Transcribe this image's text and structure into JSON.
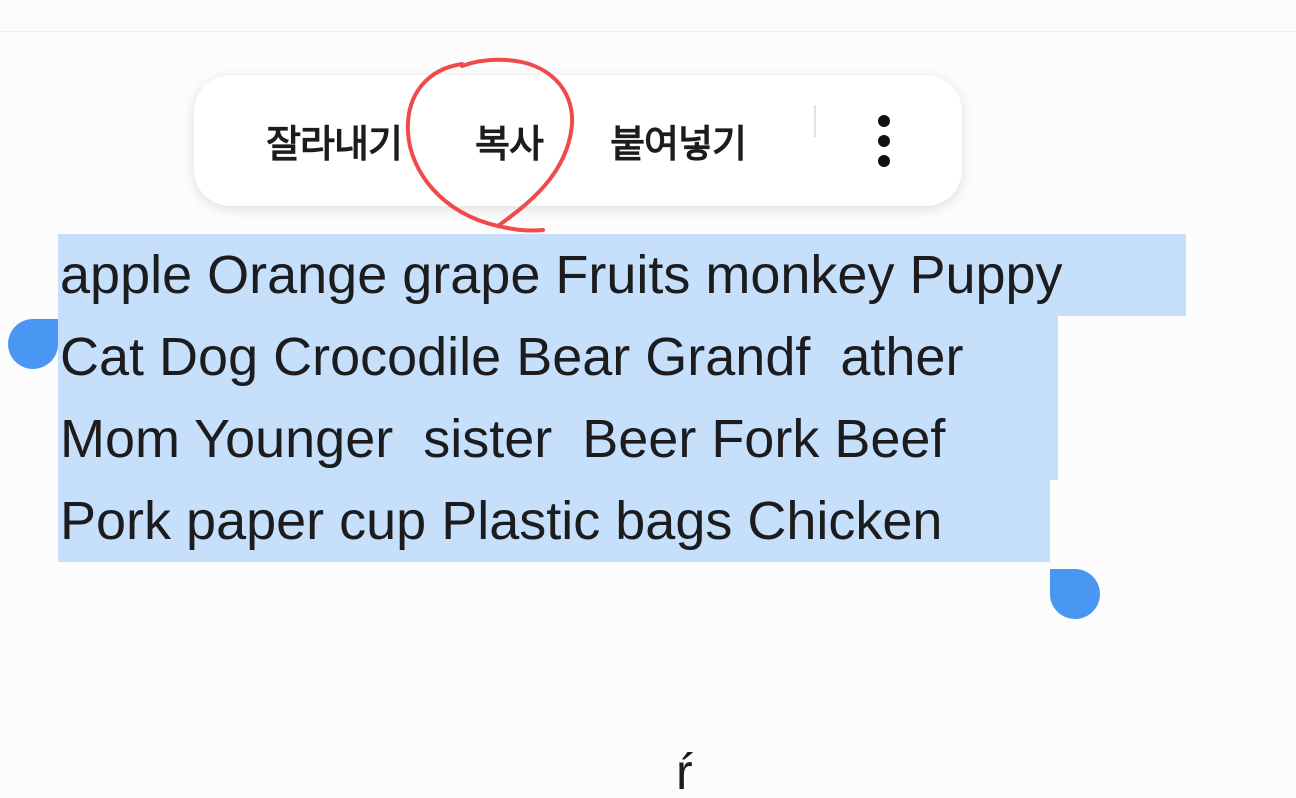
{
  "context_menu": {
    "cut_label": "잘라내기",
    "copy_label": "복사",
    "paste_label": "붙여넣기",
    "more_icon": "more-vertical-icon"
  },
  "annotation": {
    "shape": "hand-drawn circle",
    "color": "#f04a4a",
    "target": "copy"
  },
  "editor": {
    "selected_text_lines": [
      "apple Orange grape Fruits monkey Puppy",
      "Cat Dog Crocodile Bear Grandf  ather",
      "Mom Younger  sister  Beer Fork Beef",
      "Pork paper cup Plastic bags Chicken"
    ],
    "trailing_text": "ŕ",
    "selection_color": "#c6dffa",
    "handle_color": "#4a96f3"
  }
}
